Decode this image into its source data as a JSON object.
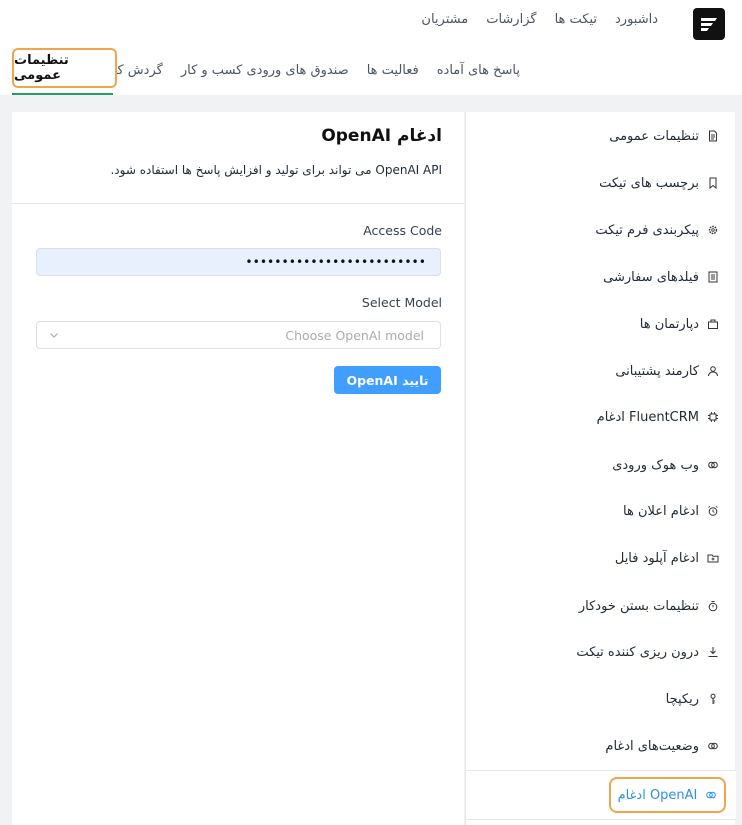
{
  "top_nav": [
    "داشبورد",
    "تیکت ها",
    "گزارشات",
    "مشتریان"
  ],
  "sub_nav": [
    "پاسخ های آماده",
    "فعالیت ها",
    "صندوق های ورودی کسب و کار",
    "گردش کارها"
  ],
  "active_tab": "تنظیمات عمومی",
  "sidebar": {
    "items": [
      {
        "label": "تنظیمات عمومی",
        "icon": "document-icon"
      },
      {
        "label": "برچسب های تیکت",
        "icon": "bookmark-icon"
      },
      {
        "label": "پیکربندی فرم تیکت",
        "icon": "gear-icon"
      },
      {
        "label": "فیلدهای سفارشی",
        "icon": "list-icon"
      },
      {
        "label": "دپارتمان ها",
        "icon": "suitcase-icon"
      },
      {
        "label": "کارمند پشتیبانی",
        "icon": "user-icon"
      },
      {
        "label": "ادغام FluentCRM",
        "icon": "chip-icon"
      },
      {
        "label": "وب هوک ورودی",
        "icon": "link-icon"
      },
      {
        "label": "ادغام اعلان ها",
        "icon": "alarm-icon"
      },
      {
        "label": "ادغام آپلود فایل",
        "icon": "folder-icon"
      },
      {
        "label": "تنظیمات بستن خودکار",
        "icon": "timer-icon"
      },
      {
        "label": "درون ریزی کننده تیکت",
        "icon": "download-icon"
      },
      {
        "label": "ریکپچا",
        "icon": "key-icon"
      },
      {
        "label": "وضعیت‌های ادغام",
        "icon": "link-icon"
      }
    ],
    "active": {
      "label": "ادغام OpenAI",
      "icon": "link-icon"
    }
  },
  "panel": {
    "title": "ادغام OpenAI",
    "description": "OpenAI API می تواند برای تولید و افزایش پاسخ ها استفاده شود.",
    "access_code_label": "Access Code",
    "access_code_value": "•••••••••••••••••••••••••",
    "select_model_label": "Select Model",
    "select_placeholder": "Choose OpenAI model",
    "submit_label": "تایید OpenAI"
  }
}
